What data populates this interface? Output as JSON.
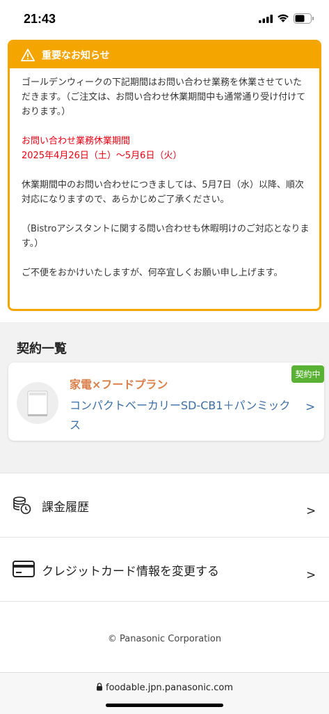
{
  "status_bar": {
    "time": "21:43"
  },
  "notice": {
    "title": "重要なお知らせ",
    "paragraph1": "ゴールデンウィークの下記期間はお問い合わせ業務を休業させていただきます。（ご注文は、お問い合わせ休業期間中も通常通り受け付けております。）",
    "period_label": "お問い合わせ業務休業期間",
    "period_dates": "2025年4月26日（土）〜5月6日（火）",
    "paragraph3": "休業期間中のお問い合わせにつきましては、5月7日（水）以降、順次対応になりますので、あらかじめご了承ください。",
    "paragraph4": "（Bistroアシスタントに関する問い合わせも休暇明けのご対応となります。）",
    "paragraph5": "ご不便をおかけいたしますが、何卒宜しくお願い申し上げます。"
  },
  "contracts": {
    "section_title": "契約一覧",
    "items": [
      {
        "badge": "契約中",
        "plan": "家電×フードプラン",
        "product": "コンパクトベーカリーSD-CB1＋パンミックス",
        "chevron": ">"
      }
    ]
  },
  "menu": {
    "items": [
      {
        "label": "課金履歴",
        "icon": "billing-history-icon",
        "chevron": ">"
      },
      {
        "label": "クレジットカード情報を変更する",
        "icon": "credit-card-icon",
        "chevron": ">"
      }
    ]
  },
  "footer": {
    "copyright": "© Panasonic Corporation"
  },
  "browser": {
    "url": "foodable.jpn.panasonic.com"
  },
  "colors": {
    "notice_accent": "#f5a500",
    "alert_red": "#e60012",
    "plan_orange": "#d9804a",
    "link_blue": "#3a6ea5",
    "badge_green": "#59b233"
  }
}
